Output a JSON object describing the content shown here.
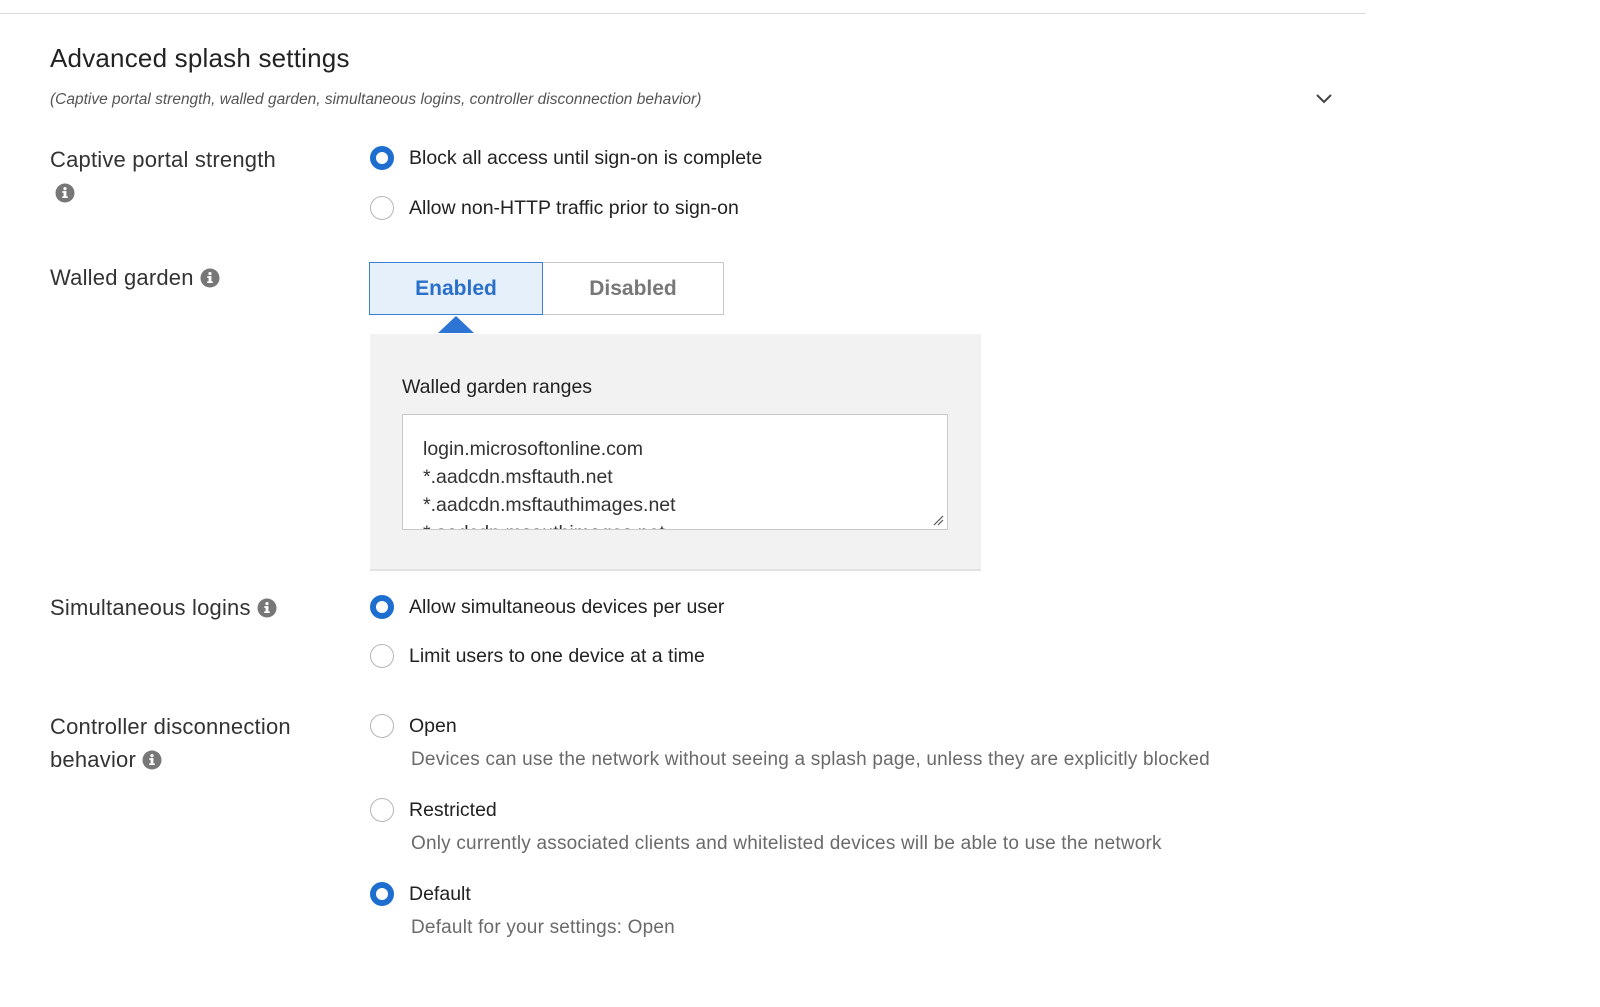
{
  "section": {
    "title": "Advanced splash settings",
    "subtitle": "(Captive portal strength, walled garden, simultaneous logins, controller disconnection behavior)"
  },
  "captive_portal": {
    "label": "Captive portal strength",
    "options": [
      {
        "label": "Block all access until sign-on is complete",
        "selected": true
      },
      {
        "label": "Allow non-HTTP traffic prior to sign-on",
        "selected": false
      }
    ]
  },
  "walled_garden": {
    "label": "Walled garden",
    "enabled_label": "Enabled",
    "disabled_label": "Disabled",
    "selected": "Enabled",
    "ranges_label": "Walled garden ranges",
    "ranges": [
      "login.microsoftonline.com",
      "*.aadcdn.msftauth.net",
      "*.aadcdn.msftauthimages.net",
      "*.aadcdn.msauthimages.net"
    ]
  },
  "simultaneous_logins": {
    "label": "Simultaneous logins",
    "options": [
      {
        "label": "Allow simultaneous devices per user",
        "selected": true
      },
      {
        "label": "Limit users to one device at a time",
        "selected": false
      }
    ]
  },
  "controller_disconnection": {
    "label_line1": "Controller disconnection",
    "label_line2": "behavior",
    "options": [
      {
        "label": "Open",
        "description": "Devices can use the network without seeing a splash page, unless they are explicitly blocked",
        "selected": false
      },
      {
        "label": "Restricted",
        "description": "Only currently associated clients and whitelisted devices will be able to use the network",
        "selected": false
      },
      {
        "label": "Default",
        "description": "Default for your settings: Open",
        "selected": true
      }
    ]
  },
  "colors": {
    "accent": "#1e6ed0",
    "segment_active_bg": "#e6f0fb",
    "panel_bg": "#f2f2f2"
  },
  "icons": {
    "collapse": "chevron-down-icon",
    "info": "info-icon",
    "resize": "resize-grip-icon"
  }
}
